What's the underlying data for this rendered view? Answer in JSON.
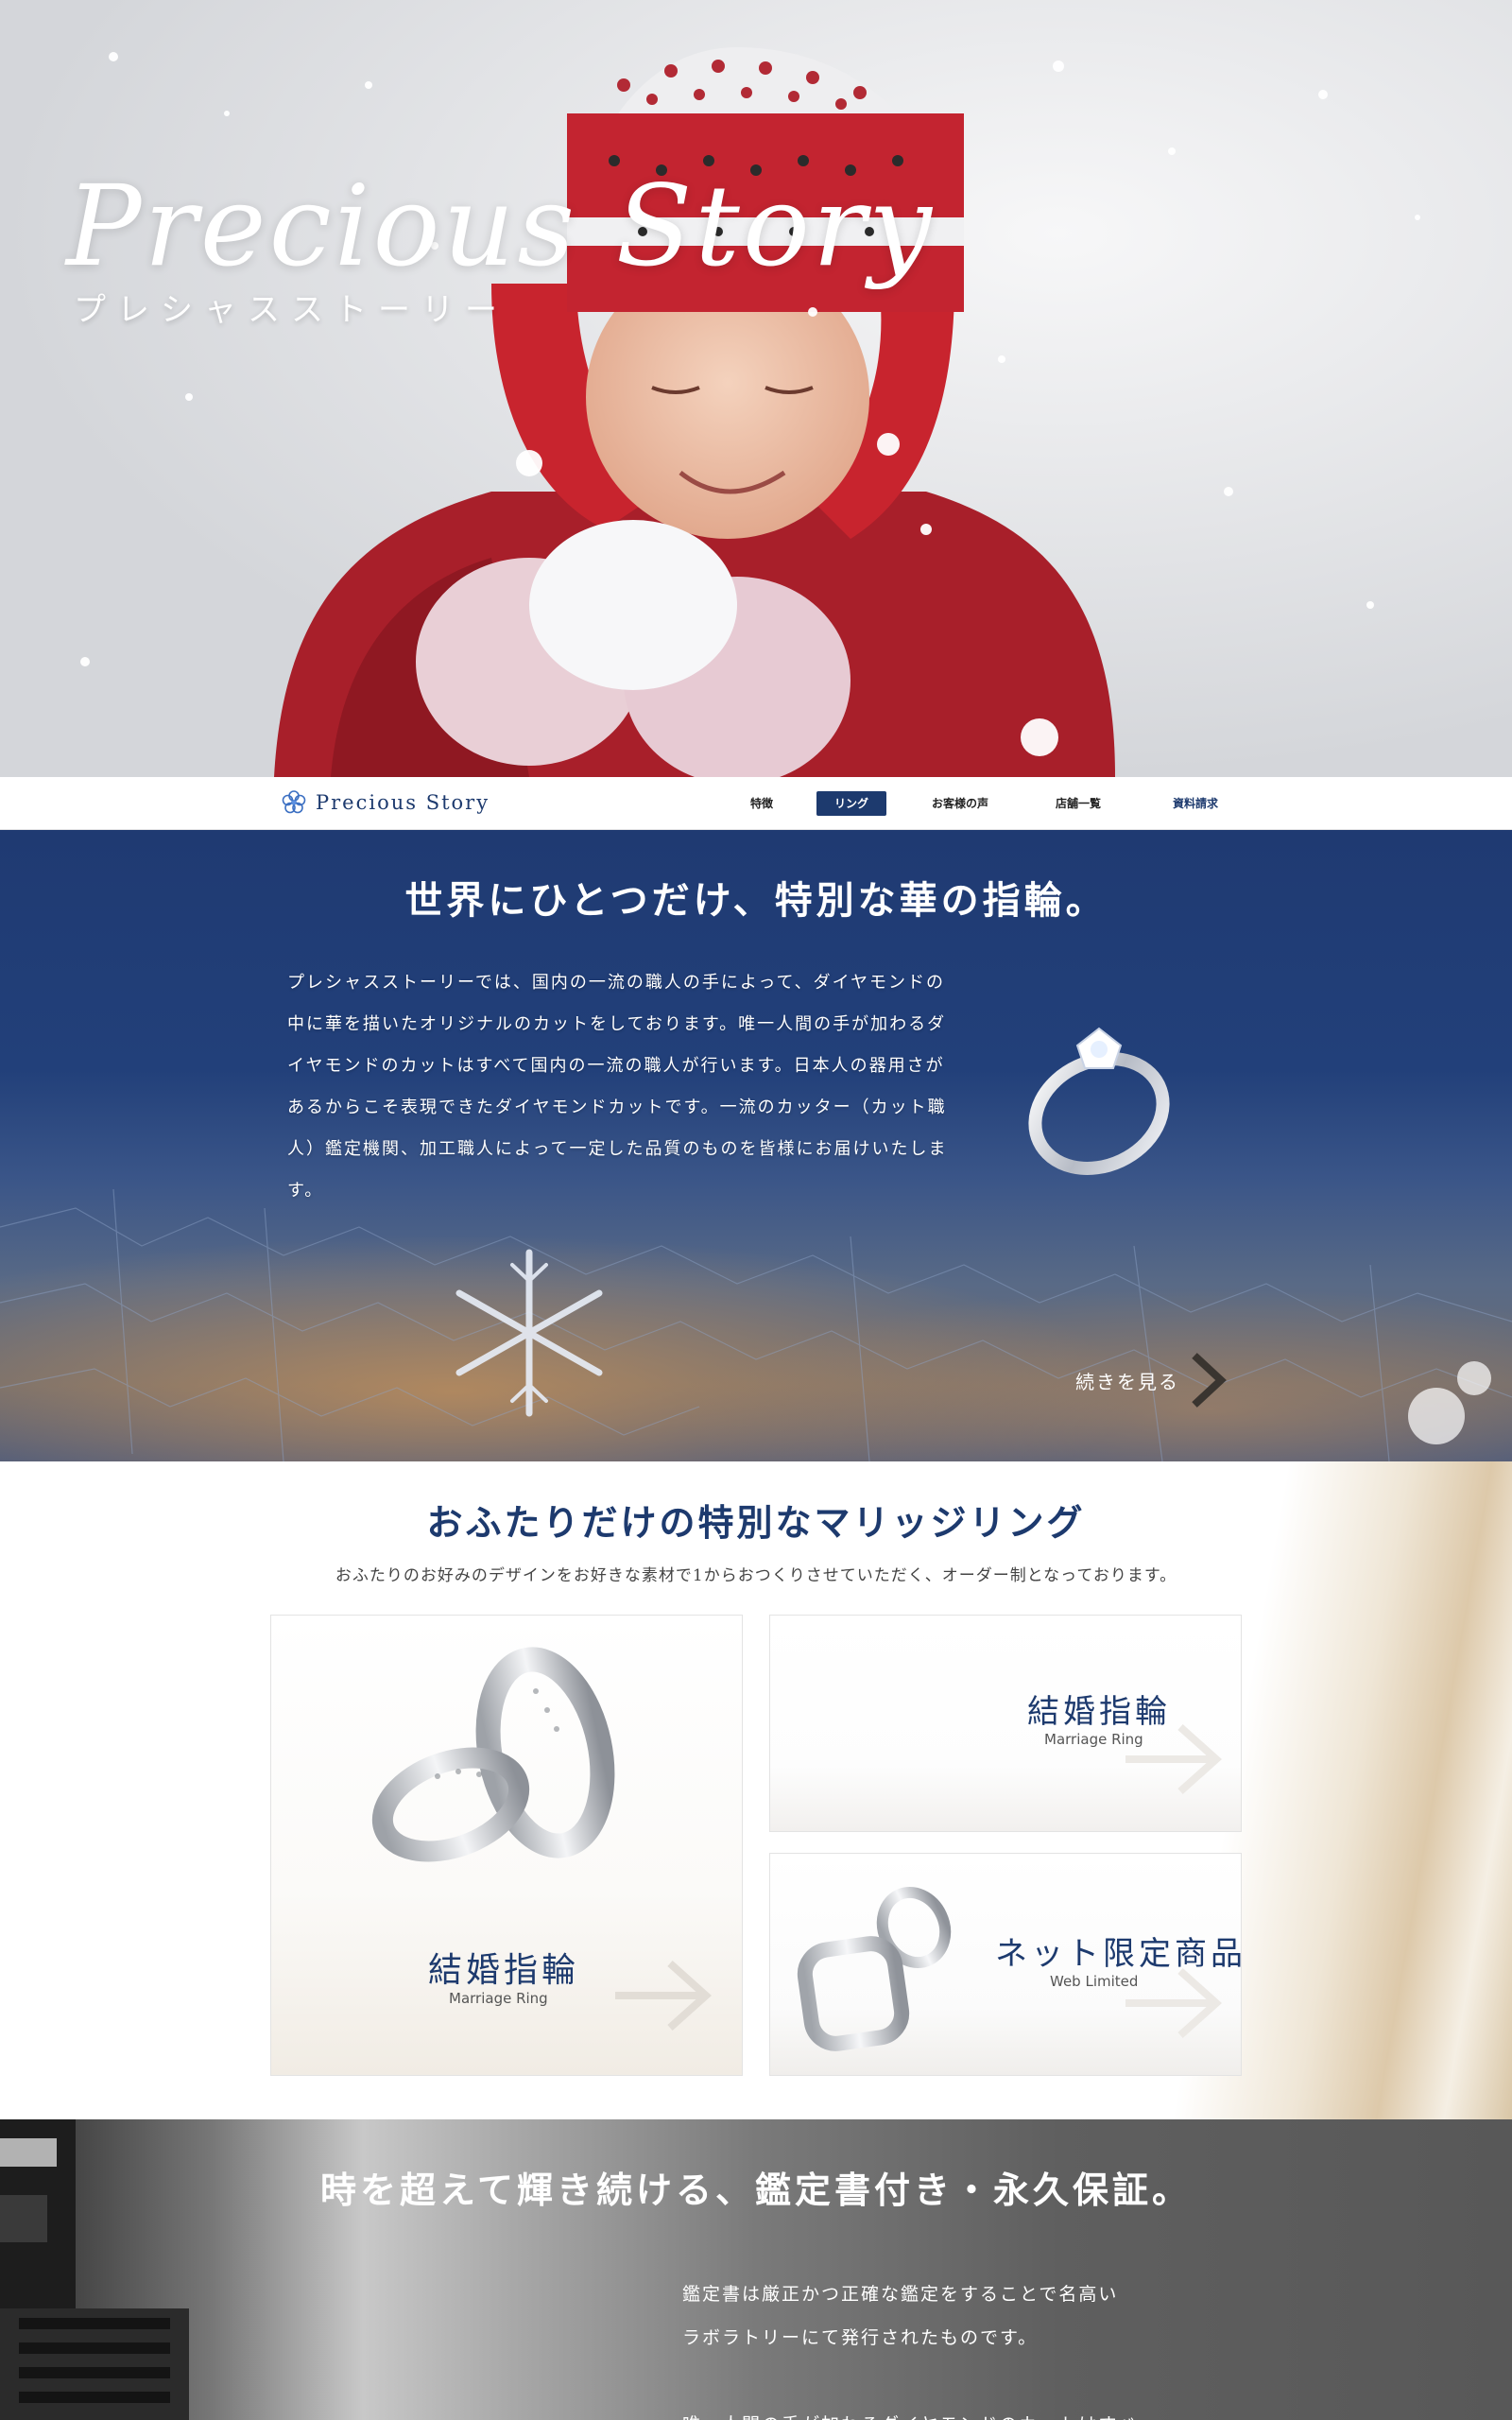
{
  "hero": {
    "title": "Precious Story",
    "subtitle": "プレシャスストーリー"
  },
  "nav": {
    "logo": "Precious Story",
    "items": [
      {
        "label": "特徴",
        "active": false
      },
      {
        "label": "リング",
        "active": true
      },
      {
        "label": "お客様の声",
        "active": false
      },
      {
        "label": "店舗一覧",
        "active": false
      },
      {
        "label": "資料請求",
        "active": false
      }
    ]
  },
  "intro": {
    "heading": "世界にひとつだけ、特別な華の指輪。",
    "body": "プレシャスストーリーでは、国内の一流の職人の手によって、ダイヤモンドの中に華を描いたオリジナルのカットをしております。唯一人間の手が加わるダイヤモンドのカットはすべて国内の一流の職人が行います。日本人の器用さがあるからこそ表現できたダイヤモンドカットです。一流のカッター（カット職人）鑑定機関、加工職人によって一定した品質のものを皆様にお届けいたします。",
    "more_label": "続きを見る"
  },
  "marriage": {
    "heading": "おふたりだけの特別なマリッジリング",
    "subheading": "おふたりのお好みのデザインをお好きな素材で1からおつくりさせていただく、オーダー制となっております。",
    "cards": [
      {
        "title": "結婚指輪",
        "subtitle": "Marriage Ring"
      },
      {
        "title": "結婚指輪",
        "subtitle": "Marriage Ring"
      },
      {
        "title": "ネット限定商品",
        "subtitle": "Web Limited"
      }
    ]
  },
  "guarantee": {
    "heading": "時を超えて輝き続ける、鑑定書付き・永久保証。",
    "lines": [
      "鑑定書は厳正かつ正確な鑑定をすることで名高い",
      "ラボラトリーにて発行されたものです。",
      "唯一人間の手が加わるダイヤモンドのカットはすべ"
    ]
  },
  "colors": {
    "brand_navy": "#1d3a6e",
    "hat_red": "#b3202a",
    "white": "#ffffff"
  }
}
